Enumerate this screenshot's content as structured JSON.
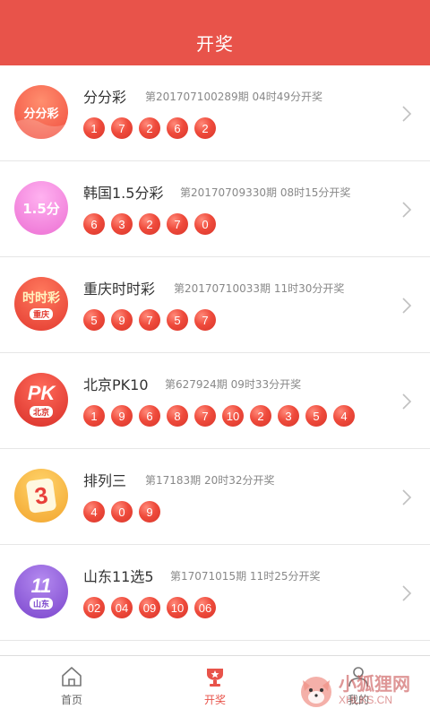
{
  "header": {
    "title": "开奖"
  },
  "lotteries": [
    {
      "name": "分分彩",
      "period": "第201707100289期",
      "time": "04时49分开奖",
      "numbers": [
        "1",
        "7",
        "2",
        "6",
        "2"
      ],
      "logo_text": "分分彩",
      "logo_color": "#f35b4d"
    },
    {
      "name": "韩国1.5分彩",
      "period": "第20170709330期",
      "time": "08时15分开奖",
      "numbers": [
        "6",
        "3",
        "2",
        "7",
        "0"
      ],
      "logo_text": "1.5分",
      "logo_color": "#f07ad6"
    },
    {
      "name": "重庆时时彩",
      "period": "第20170710033期",
      "time": "11时30分开奖",
      "numbers": [
        "5",
        "9",
        "7",
        "5",
        "7"
      ],
      "logo_text": "时时彩",
      "logo_sub": "重庆",
      "logo_color": "#f0443c"
    },
    {
      "name": "北京PK10",
      "period": "第627924期",
      "time": "09时33分开奖",
      "numbers": [
        "1",
        "9",
        "6",
        "8",
        "7",
        "10",
        "2",
        "3",
        "5",
        "4"
      ],
      "logo_text": "PK",
      "logo_sub": "北京",
      "logo_color": "#e8403a"
    },
    {
      "name": "排列三",
      "period": "第17183期",
      "time": "20时32分开奖",
      "numbers": [
        "4",
        "0",
        "9"
      ],
      "logo_text": "3",
      "logo_color": "#f5b23a"
    },
    {
      "name": "山东11选5",
      "period": "第17071015期",
      "time": "11时25分开奖",
      "numbers": [
        "02",
        "04",
        "09",
        "10",
        "06"
      ],
      "logo_text": "11",
      "logo_sub": "山东",
      "logo_color": "#8b57d8"
    }
  ],
  "tabbar": {
    "tabs": [
      {
        "label": "首页",
        "icon": "home-icon"
      },
      {
        "label": "开奖",
        "icon": "trophy-icon"
      },
      {
        "label": "我的",
        "icon": "user-icon"
      }
    ],
    "active_index": 1
  },
  "watermark": {
    "main": "小狐狸网",
    "sub": "XHLKS.CN"
  },
  "colors": {
    "accent": "#e8534a",
    "ball": "#ef4b3c"
  }
}
